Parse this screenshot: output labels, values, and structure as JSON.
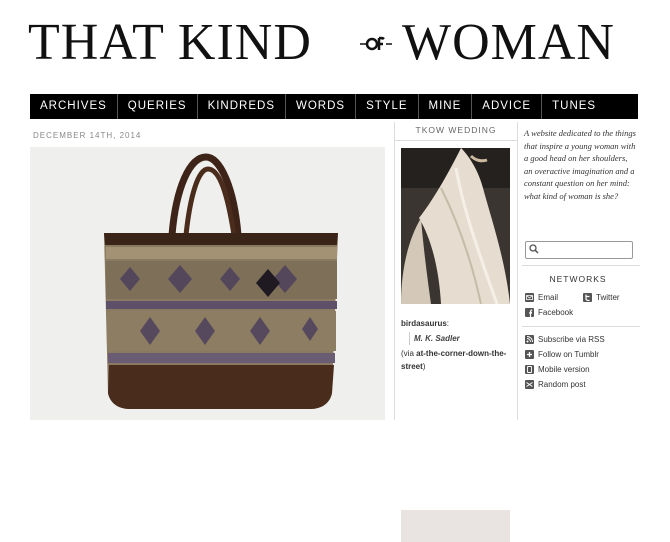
{
  "site": {
    "logo_left": "THAT KIND",
    "logo_of": "OF",
    "logo_right": "WOMAN"
  },
  "nav": {
    "items": [
      "ARCHIVES",
      "QUERIES",
      "KINDREDS",
      "WORDS",
      "STYLE",
      "MINE",
      "ADVICE",
      "TUNES"
    ]
  },
  "post": {
    "date": "DECEMBER 14TH, 2014"
  },
  "middle": {
    "title": "TKOW WEDDING",
    "caption_user": "birdasaurus",
    "caption_colon": ":",
    "caption_quote": "M. K. Sadler",
    "caption_via_prefix": "(via ",
    "caption_via_link": "at-the-corner-down-the-street",
    "caption_via_suffix": ")"
  },
  "right": {
    "tagline": "A website dedicated to the things that inspire a young woman with a good head on her shoulders, an overactive imagination and a constant question on her mind: what kind of woman is she?",
    "search_placeholder": "",
    "networks_title": "NETWORKS",
    "networks": {
      "email": "Email",
      "twitter": "Twitter",
      "facebook": "Facebook"
    },
    "links": {
      "rss": "Subscribe via RSS",
      "tumblr": "Follow on Tumblr",
      "mobile": "Mobile version",
      "random": "Random post"
    }
  },
  "colors": {
    "nav_bg": "#000000",
    "nav_text": "#ffffff"
  }
}
